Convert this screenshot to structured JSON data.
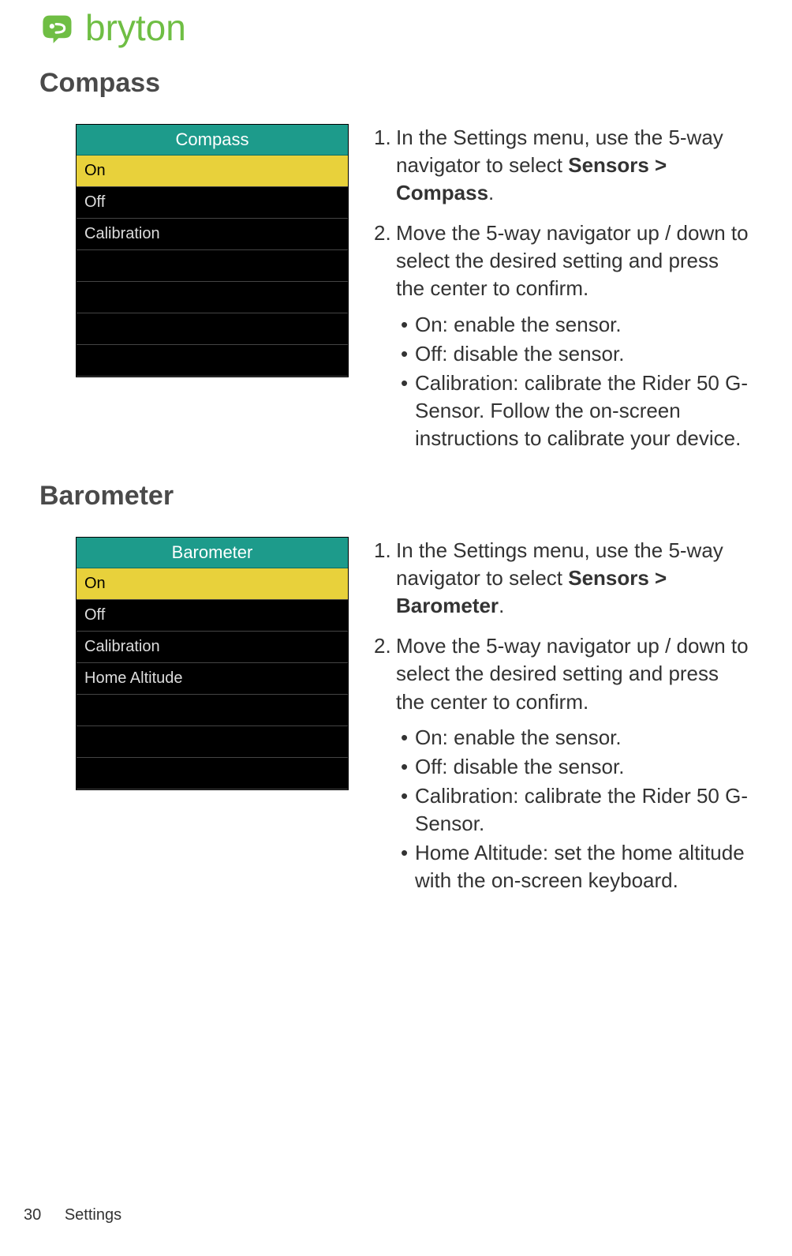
{
  "brand": "bryton",
  "section1": {
    "title": "Compass",
    "screen": {
      "header": "Compass",
      "items": [
        "On",
        "Off",
        "Calibration"
      ],
      "selected_index": 0,
      "empty_rows": 4
    },
    "steps": {
      "s1_num": "1.",
      "s1_a": "In the Settings menu, use the 5-way navigator to select ",
      "s1_b": "Sensors > Compass",
      "s1_c": ".",
      "s2_num": "2.",
      "s2": "Move the 5-way navigator up / down to select the desired setting and press the center to confirm.",
      "bullets": [
        "On: enable the sensor.",
        "Off: disable the sensor.",
        "Calibration: calibrate the Rider 50 G-Sensor. Follow the on-screen instructions to calibrate your device."
      ]
    }
  },
  "section2": {
    "title": "Barometer",
    "screen": {
      "header": "Barometer",
      "items": [
        "On",
        "Off",
        "Calibration",
        "Home Altitude"
      ],
      "selected_index": 0,
      "empty_rows": 3
    },
    "steps": {
      "s1_num": "1.",
      "s1_a": "In the Settings menu, use the 5-way navigator to select ",
      "s1_b": "Sensors > Barometer",
      "s1_c": ".",
      "s2_num": "2.",
      "s2": "Move the 5-way navigator up / down to select the desired setting and press the center to confirm.",
      "bullets": [
        "On: enable the sensor.",
        "Off: disable the sensor.",
        "Calibration: calibrate the Rider 50 G-Sensor.",
        "Home Altitude: set the home altitude with the on-screen keyboard."
      ]
    }
  },
  "footer": {
    "page": "30",
    "label": "Settings"
  }
}
